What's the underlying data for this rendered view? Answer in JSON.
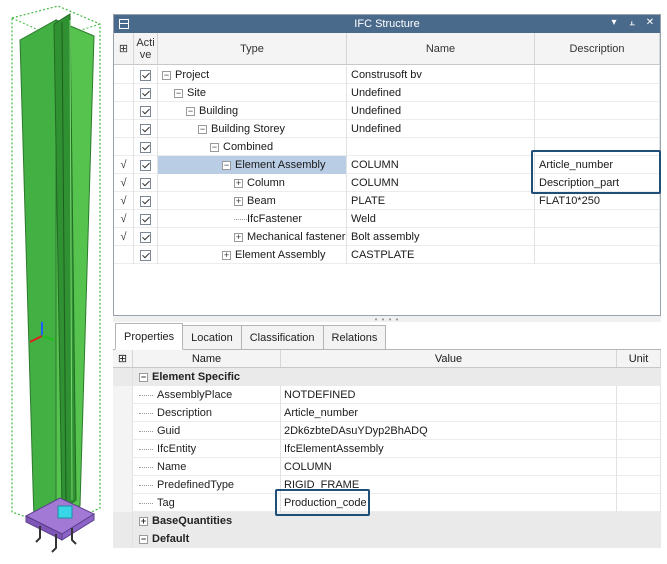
{
  "ifc_panel": {
    "title": "IFC Structure",
    "columns": {
      "active": "Active",
      "type": "Type",
      "name": "Name",
      "description": "Description"
    },
    "rows": [
      {
        "mark": "",
        "level": 0,
        "expander": "⊟",
        "type": "Project",
        "name": "Construsoft bv",
        "description": ""
      },
      {
        "mark": "",
        "level": 1,
        "expander": "⊟",
        "type": "Site",
        "name": "Undefined",
        "description": ""
      },
      {
        "mark": "",
        "level": 2,
        "expander": "⊟",
        "type": "Building",
        "name": "Undefined",
        "description": ""
      },
      {
        "mark": "",
        "level": 3,
        "expander": "⊟",
        "type": "Building Storey",
        "name": "Undefined",
        "description": ""
      },
      {
        "mark": "",
        "level": 4,
        "expander": "⊟",
        "type": "Combined",
        "name": "",
        "description": ""
      },
      {
        "mark": "√",
        "level": 5,
        "expander": "⊟",
        "type": "Element Assembly",
        "name": "COLUMN",
        "description": "Article_number",
        "selected": true
      },
      {
        "mark": "√",
        "level": 6,
        "expander": "⊞",
        "type": "Column",
        "name": "COLUMN",
        "description": "Description_part"
      },
      {
        "mark": "√",
        "level": 6,
        "expander": "⊞",
        "type": "Beam",
        "name": "PLATE",
        "description": "FLAT10*250"
      },
      {
        "mark": "√",
        "level": 6,
        "expander": "",
        "type": "IfcFastener",
        "name": "Weld",
        "description": ""
      },
      {
        "mark": "√",
        "level": 6,
        "expander": "⊞",
        "type": "Mechanical fastener",
        "name": "Bolt assembly",
        "description": ""
      },
      {
        "mark": "",
        "level": 5,
        "expander": "⊞",
        "type": "Element Assembly",
        "name": "CASTPLATE",
        "description": ""
      }
    ]
  },
  "properties_panel": {
    "tabs": [
      "Properties",
      "Location",
      "Classification",
      "Relations"
    ],
    "active_tab": "Properties",
    "columns": {
      "name": "Name",
      "value": "Value",
      "unit": "Unit"
    },
    "groups": [
      {
        "expander": "⊟",
        "label": "Element Specific",
        "items": [
          {
            "name": "AssemblyPlace",
            "value": "NOTDEFINED"
          },
          {
            "name": "Description",
            "value": "Article_number"
          },
          {
            "name": "Guid",
            "value": "2Dk6zbteDAsuYDyp2BhADQ"
          },
          {
            "name": "IfcEntity",
            "value": "IfcElementAssembly"
          },
          {
            "name": "Name",
            "value": "COLUMN"
          },
          {
            "name": "PredefinedType",
            "value": "RIGID_FRAME"
          },
          {
            "name": "Tag",
            "value": "Production_code"
          }
        ]
      },
      {
        "expander": "⊞",
        "label": "BaseQuantities",
        "items": []
      },
      {
        "expander": "⊟",
        "label": "Default",
        "items": []
      }
    ]
  },
  "colors": {
    "titlebar": "#4a6a8c",
    "selection": "#b9cde5",
    "highlight_box": "#1f4e79",
    "column_green": "#3ea83a"
  }
}
